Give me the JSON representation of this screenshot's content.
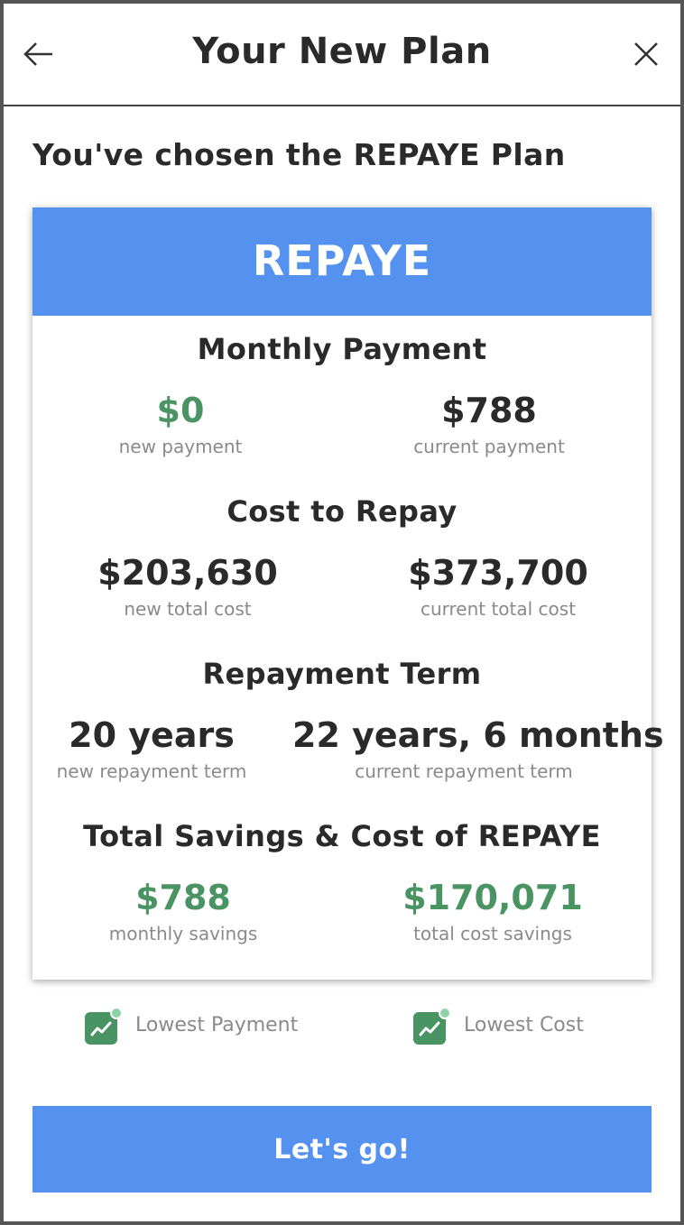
{
  "header": {
    "title": "Your New Plan",
    "back_icon": "arrow-left-icon",
    "close_icon": "close-icon"
  },
  "subtitle": "You've chosen the REPAYE Plan",
  "plan_card": {
    "plan_name": "REPAYE",
    "banner_color": "#5592f0",
    "sections": {
      "monthly_payment": {
        "title": "Monthly Payment",
        "new_value": "$0",
        "new_label": "new payment",
        "current_value": "$788",
        "current_label": "current payment"
      },
      "cost_to_repay": {
        "title": "Cost to Repay",
        "new_value": "$203,630",
        "new_label": "new total cost",
        "current_value": "$373,700",
        "current_label": "current total cost"
      },
      "repayment_term": {
        "title": "Repayment Term",
        "new_value": "20 years",
        "new_label": "new repayment term",
        "current_value": "22 years, 6 months",
        "current_label": "current repayment term"
      },
      "savings": {
        "title": "Total Savings & Cost of REPAYE",
        "monthly_value": "$788",
        "monthly_label": "monthly savings",
        "total_value": "$170,071",
        "total_label": "total cost savings"
      }
    }
  },
  "badges": [
    {
      "label": "Lowest Payment",
      "icon": "trend-up-icon"
    },
    {
      "label": "Lowest Cost",
      "icon": "trend-up-icon"
    }
  ],
  "cta_label": "Let's go!",
  "colors": {
    "accent": "#5592f0",
    "positive": "#4a9463",
    "text": "#2a2a2a",
    "muted": "#8a8a8a"
  }
}
